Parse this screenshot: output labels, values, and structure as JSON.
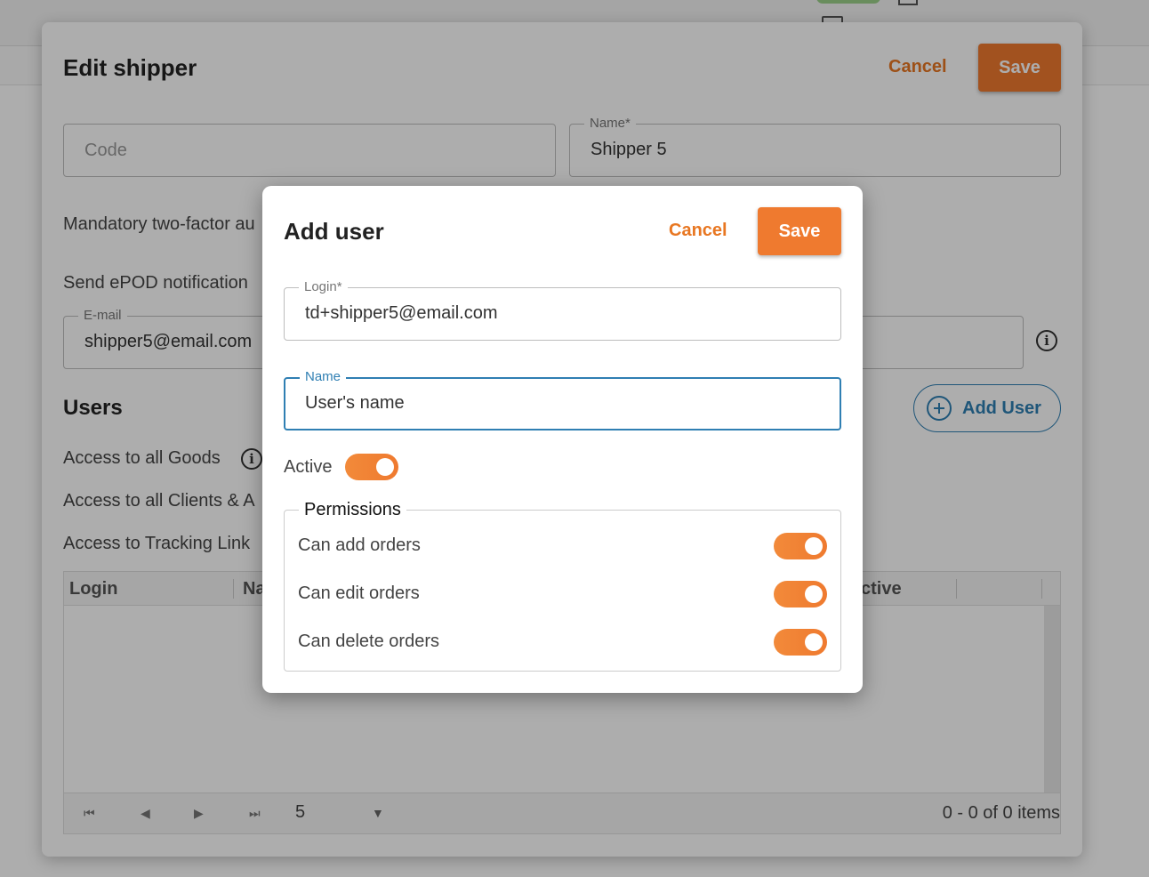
{
  "edit_shipper": {
    "title": "Edit shipper",
    "cancel_label": "Cancel",
    "save_label": "Save",
    "code_placeholder": "Code",
    "name_label": "Name*",
    "name_value": "Shipper 5",
    "mandatory_2fa_text": "Mandatory two-factor au",
    "send_epod_text": "Send ePOD notification",
    "email_label": "E-mail",
    "email_value": "shipper5@email.com",
    "users_heading": "Users",
    "add_user_label": "Add User",
    "access_goods_text": "Access to all Goods",
    "access_clients_text": "Access to all Clients & A",
    "access_tracking_text": "Access to Tracking Link",
    "grid": {
      "columns": [
        "Login",
        "Na",
        "ctive"
      ],
      "page_size": "5",
      "pager_info": "0 - 0 of 0 items"
    }
  },
  "add_user": {
    "title": "Add user",
    "cancel_label": "Cancel",
    "save_label": "Save",
    "login_label": "Login*",
    "login_value": "td+shipper5@email.com",
    "name_label": "Name",
    "name_value": "User's name",
    "active_label": "Active",
    "active_on": true,
    "permissions_legend": "Permissions",
    "permissions": [
      {
        "label": "Can add orders",
        "on": true
      },
      {
        "label": "Can edit orders",
        "on": true
      },
      {
        "label": "Can delete orders",
        "on": true
      }
    ]
  },
  "colors": {
    "accent_orange": "#ef7a2f",
    "accent_blue": "#2f7fb3"
  }
}
